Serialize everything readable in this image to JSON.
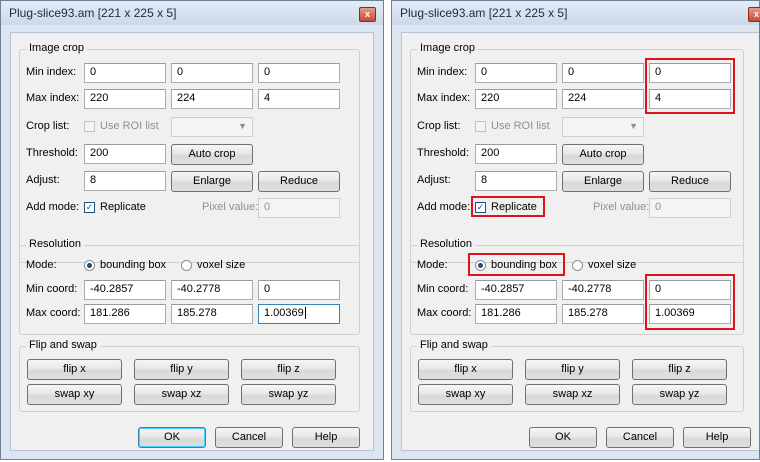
{
  "title": "Plug-slice93.am [221 x 225 x 5]",
  "close_glyph": "x",
  "crop": {
    "group_title": "Image crop",
    "min_label": "Min index:",
    "min": [
      "0",
      "0",
      "0"
    ],
    "max_label": "Max index:",
    "max": [
      "220",
      "224",
      "4"
    ],
    "croplist_label": "Crop list:",
    "use_roi_label": "Use ROI list",
    "threshold_label": "Threshold:",
    "threshold": "200",
    "autocrop_label": "Auto crop",
    "adjust_label": "Adjust:",
    "adjust": "8",
    "enlarge_label": "Enlarge",
    "reduce_label": "Reduce",
    "addmode_label": "Add mode:",
    "replicate_label": "Replicate",
    "pixel_value_label": "Pixel value:",
    "pixel_value": "0"
  },
  "resolution": {
    "group_title": "Resolution",
    "mode_label": "Mode:",
    "bbox_label": "bounding box",
    "voxel_label": "voxel size",
    "mincoord_label": "Min coord:",
    "min": [
      "-40.2857",
      "-40.2778",
      "0"
    ],
    "maxcoord_label": "Max coord:",
    "max": [
      "181.286",
      "185.278",
      "1.00369"
    ]
  },
  "flip": {
    "group_title": "Flip and swap",
    "flip_x": "flip x",
    "flip_y": "flip y",
    "flip_z": "flip z",
    "swap_xy": "swap xy",
    "swap_xz": "swap xz",
    "swap_yz": "swap yz"
  },
  "footer": {
    "ok": "OK",
    "cancel": "Cancel",
    "help": "Help"
  },
  "state": {
    "use_roi_checked": false,
    "replicate_checked": true,
    "mode_selected": "bounding box"
  },
  "colors": {
    "highlight": "#e0121b",
    "accent": "#3c7fb1"
  }
}
